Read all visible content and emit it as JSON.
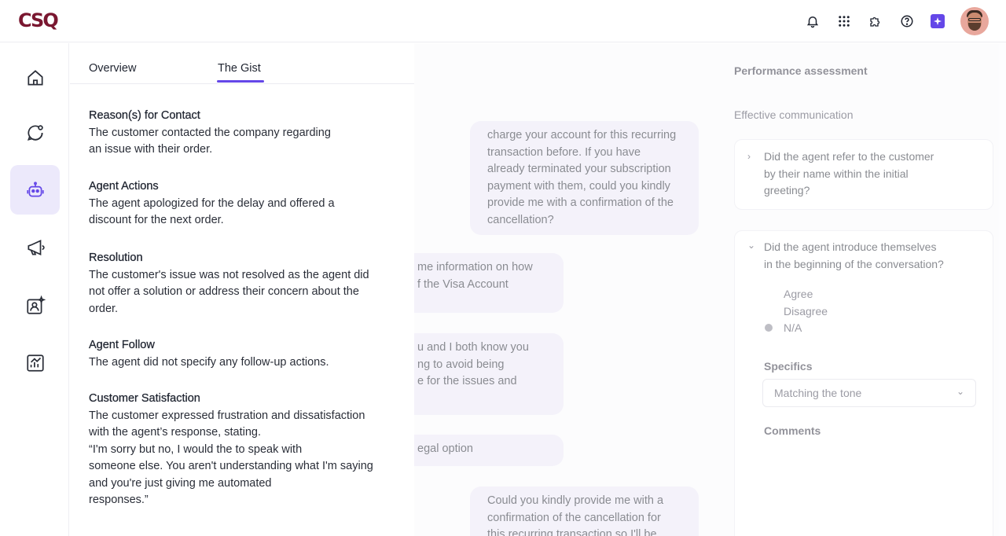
{
  "app": {
    "logo": "CSQ"
  },
  "topbar": {
    "icons": [
      "bell-icon",
      "grid-icon",
      "puzzle-icon",
      "help-icon",
      "ai-sparkle-icon",
      "avatar"
    ]
  },
  "sidebar": {
    "items": [
      {
        "name": "home-icon",
        "active": false
      },
      {
        "name": "chat-icon",
        "active": false
      },
      {
        "name": "robot-icon",
        "active": true
      },
      {
        "name": "megaphone-icon",
        "active": false
      },
      {
        "name": "contact-spark-icon",
        "active": false
      },
      {
        "name": "analytics-icon",
        "active": false
      }
    ],
    "active_color": "#ece9fb"
  },
  "gist": {
    "tabs": [
      {
        "label": "Overview",
        "active": false
      },
      {
        "label": "The Gist",
        "active": true
      }
    ],
    "accent": "#6447e8",
    "sections": [
      {
        "title": "Reason(s) for Contact",
        "lines": [
          "The customer contacted the company regarding",
          "an issue with their order."
        ]
      },
      {
        "title": "Agent Actions",
        "lines": [
          "The agent apologized for the delay and offered a",
          "discount for the next order."
        ]
      },
      {
        "title": "Resolution",
        "lines": [
          "The customer's issue was not resolved as the agent did",
          "not offer a solution or address their concern about the",
          "order."
        ]
      },
      {
        "title": "Agent Follow",
        "lines": [
          "The agent did not specify any follow-up actions."
        ]
      },
      {
        "title": "Customer Satisfaction",
        "lines": [
          "The customer expressed frustration and dissatisfaction",
          "with the agent’s response, stating.",
          "“I'm sorry but no, I would the to speak with",
          "someone else. You aren't understanding what I'm saying",
          "and you're just giving me automated",
          "responses.”"
        ]
      }
    ]
  },
  "conversation": {
    "bubbles": [
      {
        "lines": [
          "charge your account for this recurring",
          "transaction before. If you have",
          "already terminated your subscription",
          "payment with them, could you kindly",
          "provide me with a confirmation of the",
          "cancellation?"
        ]
      },
      {
        "lines": [
          "me information on how",
          "f the Visa Account"
        ]
      },
      {
        "lines": [
          "u and I both know you",
          "ng to avoid being",
          "e for the issues and"
        ]
      },
      {
        "lines": [
          "egal option"
        ]
      },
      {
        "lines": [
          "Could you kindly provide me with a",
          "confirmation of the cancellation for",
          "this recurring transaction so I'll be"
        ]
      }
    ]
  },
  "assessment": {
    "title": "Performance assessment",
    "category": "Effective communication",
    "q1": {
      "lines": [
        "Did the agent refer to the customer",
        "by their name within the initial",
        "greeting?"
      ],
      "chevron": "›"
    },
    "q2": {
      "lines": [
        "Did the agent introduce themselves",
        "in the beginning of the conversation?"
      ],
      "chevron": "⌄"
    },
    "options": [
      "Agree",
      "Disagree",
      "N/A"
    ],
    "selected_option": "N/A",
    "specifics_label": "Specifics",
    "specifics_value": "Matching the tone",
    "comments_label": "Comments"
  }
}
